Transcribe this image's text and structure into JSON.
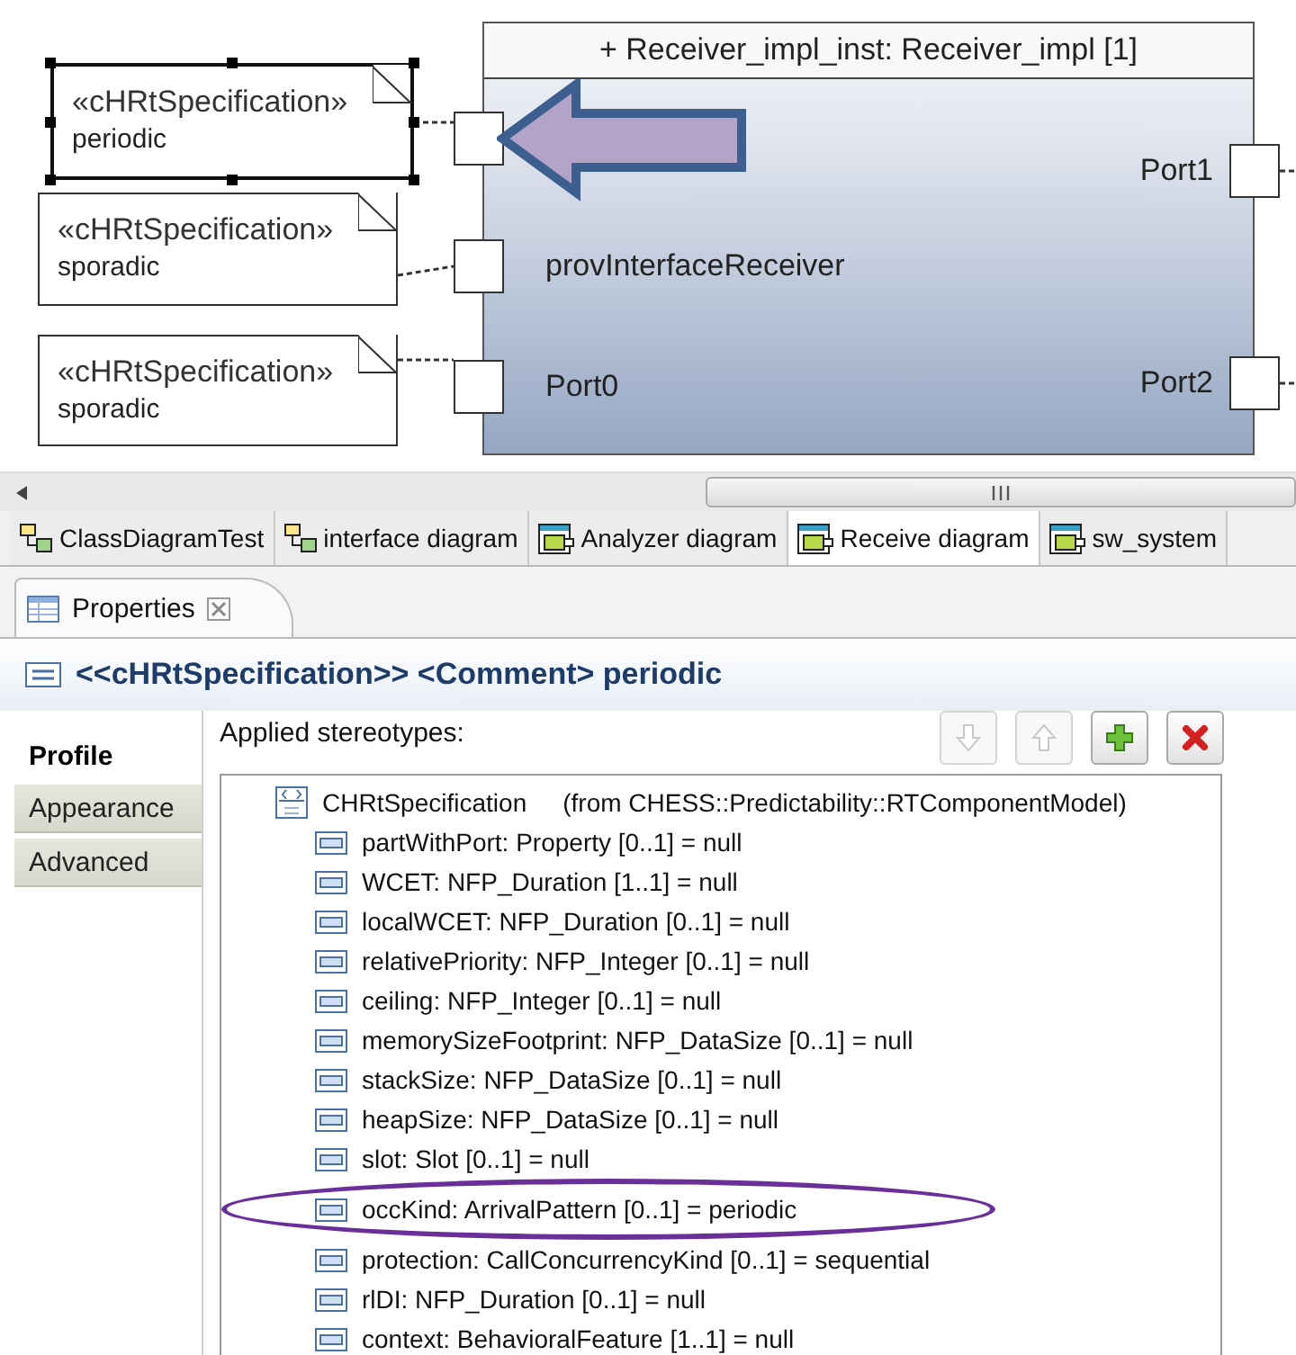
{
  "diagram": {
    "part": {
      "title": "+ Receiver_impl_inst: Receiver_impl [1]"
    },
    "notes": [
      {
        "stereotype": "«cHRtSpecification»",
        "body": "periodic",
        "selected": true
      },
      {
        "stereotype": "«cHRtSpecification»",
        "body": "sporadic",
        "selected": false
      },
      {
        "stereotype": "«cHRtSpecification»",
        "body": "sporadic",
        "selected": false
      }
    ],
    "left_ports": [
      {
        "kind": "plain"
      },
      {
        "kind": "labeled",
        "label": "provInterfaceReceiver"
      },
      {
        "kind": "labeled",
        "label": "Port0"
      }
    ],
    "right_ports": [
      {
        "label": "Port1"
      },
      {
        "label": "Port2"
      }
    ]
  },
  "editor_tabs": [
    {
      "label": "ClassDiagramTest",
      "kind": "class",
      "selected": false
    },
    {
      "label": "interface diagram",
      "kind": "class",
      "selected": false
    },
    {
      "label": "Analyzer diagram",
      "kind": "composite",
      "selected": false
    },
    {
      "label": "Receive diagram",
      "kind": "composite",
      "selected": true
    },
    {
      "label": "sw_system",
      "kind": "composite",
      "selected": false
    }
  ],
  "properties_view": {
    "title": "Properties",
    "header": {
      "stereotype": "<<cHRtSpecification>>",
      "element": "<Comment> periodic"
    },
    "side_tabs": [
      {
        "label": "Profile",
        "selected": true
      },
      {
        "label": "Appearance",
        "selected": false
      },
      {
        "label": "Advanced",
        "selected": false
      }
    ],
    "applied_label": "Applied stereotypes:",
    "buttons": [
      {
        "kind": "down",
        "disabled": true
      },
      {
        "kind": "up",
        "disabled": true
      },
      {
        "kind": "add",
        "disabled": false
      },
      {
        "kind": "remove",
        "disabled": false
      }
    ],
    "tree": {
      "name": "CHRtSpecification",
      "source": "(from CHESS::Predictability::RTComponentModel)",
      "children": [
        {
          "label": "partWithPort: Property [0..1] = null",
          "circled": false
        },
        {
          "label": "WCET: NFP_Duration [1..1] = null",
          "circled": false
        },
        {
          "label": "localWCET: NFP_Duration [0..1] = null",
          "circled": false
        },
        {
          "label": "relativePriority: NFP_Integer [0..1] = null",
          "circled": false
        },
        {
          "label": "ceiling: NFP_Integer [0..1] = null",
          "circled": false
        },
        {
          "label": "memorySizeFootprint: NFP_DataSize [0..1] = null",
          "circled": false
        },
        {
          "label": "stackSize: NFP_DataSize [0..1] = null",
          "circled": false
        },
        {
          "label": "heapSize: NFP_DataSize [0..1] = null",
          "circled": false
        },
        {
          "label": "slot: Slot [0..1] = null",
          "circled": false
        },
        {
          "label": "occKind: ArrivalPattern [0..1] = periodic",
          "circled": true
        },
        {
          "label": "protection: CallConcurrencyKind [0..1] = sequential",
          "circled": false
        },
        {
          "label": "rlDI: NFP_Duration [0..1] = null",
          "circled": false
        },
        {
          "label": "context: BehavioralFeature [1..1] = null",
          "circled": false
        }
      ]
    }
  }
}
